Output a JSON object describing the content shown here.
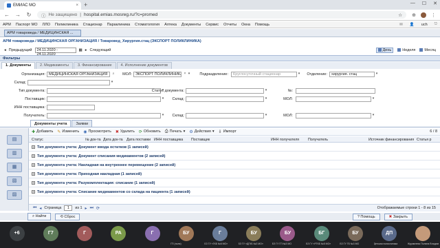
{
  "browser": {
    "tab_title": "ЕМИАС МО",
    "tab_close": "×",
    "new_tab": "+",
    "security": "Не защищено",
    "url": "hospital.emias.mosreg.ru/?c=promed",
    "win_min": "—",
    "win_max": "☐",
    "win_close": "✕"
  },
  "menu": {
    "items": [
      "АРМ",
      "Паспорт МО",
      "ЛЛО",
      "Поликлиника",
      "Стационар",
      "Параклиника",
      "Стоматология",
      "Аптека",
      "Документы",
      "Сервис",
      "Отчеты",
      "Окна",
      "Помощь"
    ],
    "user": "uch"
  },
  "app_tab": "АРМ товароведа / МЕДИЦИНСКАЯ ...",
  "breadcrumb": "АРМ товароведа / МЕДИЦИНСКАЯ ОРГАНИЗАЦИЯ / Товаровед_Хирургия.стац (ЭКСПОРТ ПОЛИКЛИНИКА)",
  "period": {
    "prev": "Предыдущий",
    "range": "24.11.2020 - 24.11.2020",
    "next": "Следующий",
    "day": "День",
    "week": "Неделя",
    "month": "Месяц"
  },
  "filters": {
    "header": "Фильтры",
    "tabs": [
      "1. Документы",
      "2. Медикаменты",
      "3. Финансирование",
      "4. Исполнение документов"
    ],
    "org_label": "Организация:",
    "org_value": "МЕДИЦИНСКАЯ ОРГАНИЗАЦИЯ",
    "mol_label": "МОЛ:",
    "mol_value": "ЭКСПОРТ ПОЛИКЛИНИКА",
    "dept_label": "Подразделение:",
    "dept_placeholder": "Круглосуточный стационар",
    "branch_label": "Отделение:",
    "branch_value": "хирургия. стац",
    "warehouse_label": "Склад:",
    "doctype_label": "Тип документа:",
    "docstatus_label": "Статус документа:",
    "num_label": "№:",
    "supplier_label": "Поставщик:",
    "warehouse2_label": "Склад:",
    "mol2_label": "МОЛ:",
    "inn_label": "ИНН поставщика:",
    "recipient_label": "Получатель:",
    "warehouse3_label": "Склад:",
    "mol3_label": "МОЛ:"
  },
  "grid": {
    "tabs": [
      "Документы учета",
      "Заявки"
    ],
    "toolbar": {
      "add": "Добавить",
      "edit": "Изменить",
      "view": "Просмотреть",
      "delete": "Удалить",
      "refresh": "Обновить",
      "print": "Печать",
      "actions": "Действия",
      "import": "Импорт",
      "count": "6 / 8"
    },
    "columns": [
      "Статус",
      "№ док-та",
      "Дата док-та",
      "Дата поставки",
      "ИНН поставщика",
      "Поставщик",
      "ИНН получателя",
      "Получатель",
      "Источник финансирования",
      "Статья р"
    ],
    "groups": [
      "Тип документа учета: Документ ввода остатков (1 записей)",
      "Тип документа учета: Документ списания медикаментов (2 записей)",
      "Тип документа учета: Накладная на внутреннее перемещение (2 записей)",
      "Тип документа учета: Приходная накладная (1 записей)",
      "Тип документа учета: Разукомплектация: списание (1 записей)",
      "Тип документа учета: Списание медикаментов со склада на пациента (1 записей)"
    ],
    "pager": {
      "page_label": "Страница",
      "page_value": "1",
      "of_label": "из 1",
      "shown": "Отображаемые строки 1 - 8 из 15"
    }
  },
  "buttons": {
    "find": "Найти",
    "reset": "Сброс",
    "help": "Помощь",
    "close": "Закрыть"
  },
  "participants": [
    {
      "initials": "+6",
      "color": "#3c4043",
      "label": ""
    },
    {
      "initials": "Г7",
      "color": "#5f7c5a",
      "label": ""
    },
    {
      "initials": "Г",
      "color": "#a25b5b",
      "label": ""
    },
    {
      "initials": "РА",
      "color": "#7b9a4a",
      "label": ""
    },
    {
      "initials": "Г",
      "color": "#8a6fb0",
      "label": ""
    },
    {
      "initials": "БУ",
      "color": "#a07858",
      "label": "ГП (поли)"
    },
    {
      "initials": "Г",
      "color": "#6a7d9a",
      "label": "БЗ ГУ «ГКБ №6 МО»"
    },
    {
      "initials": "БУ",
      "color": "#8a7d5a",
      "label": "БЗ ГУ «ДГКБ №3 МО»"
    },
    {
      "initials": "БУ",
      "color": "#9a5a8a",
      "label": "БЗ ГУ ГП №3 МО"
    },
    {
      "initials": "БГ",
      "color": "#5a8a7a",
      "label": "БЗ ГУ «РГКБ №5 МО»"
    },
    {
      "initials": "БУ",
      "color": "#7a6a5a",
      "label": "БЗ ГУ ГБ №3 МО"
    },
    {
      "initials": "ДП",
      "color": "#5a6a8a",
      "label": "Детская поликлиника"
    },
    {
      "initials": "",
      "color": "#c49a7a",
      "label": "Журавлева Полина Владимировна"
    }
  ]
}
